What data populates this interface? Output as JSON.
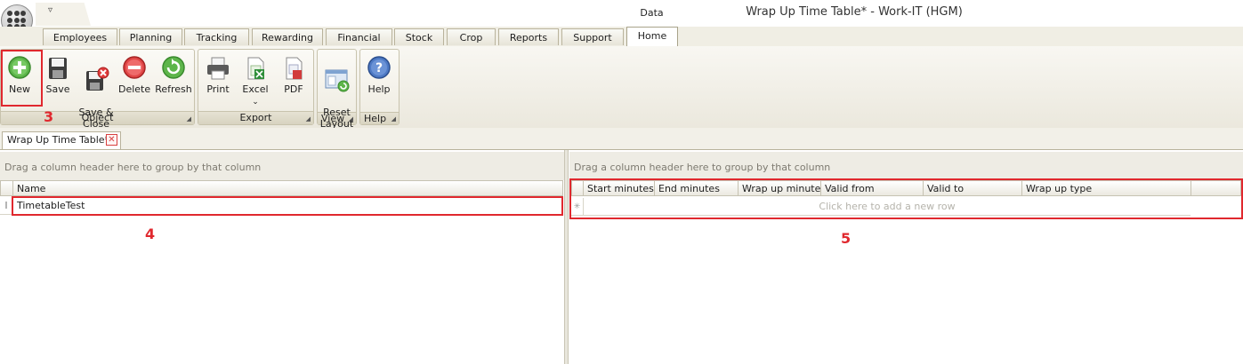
{
  "window": {
    "title": "Wrap Up Time Table* - Work-IT (HGM)",
    "context_tab": "Data"
  },
  "quick_access": {
    "arrow": "▿"
  },
  "ribbon_tabs": [
    {
      "label": "Employees"
    },
    {
      "label": "Planning"
    },
    {
      "label": "Tracking"
    },
    {
      "label": "Rewarding"
    },
    {
      "label": "Financial"
    },
    {
      "label": "Stock"
    },
    {
      "label": "Crop"
    },
    {
      "label": "Reports"
    },
    {
      "label": "Support"
    },
    {
      "label": "Home"
    }
  ],
  "active_tab": "Home",
  "ribbon": {
    "groups": {
      "object": "Object",
      "export": "Export",
      "view": "View",
      "help": "Help"
    },
    "buttons": {
      "new": "New",
      "save": "Save",
      "save_close": "Save &\nClose",
      "delete": "Delete",
      "refresh": "Refresh",
      "print": "Print",
      "excel": "Excel",
      "excel_arrow": "⌄",
      "pdf": "PDF",
      "reset_layout": "Reset\nLayout",
      "help": "Help"
    },
    "icons": {
      "new": "plus-circle-icon",
      "save": "floppy-icon",
      "save_close": "floppy-close-icon",
      "delete": "delete-circle-icon",
      "refresh": "refresh-circle-icon",
      "print": "printer-icon",
      "excel": "excel-icon",
      "pdf": "pdf-icon",
      "reset_layout": "reset-layout-icon",
      "help": "help-icon"
    }
  },
  "annotations": {
    "a3": "3",
    "a4": "4",
    "a5": "5"
  },
  "document_tab": {
    "label": "Wrap Up Time Table*",
    "close": "✕"
  },
  "left_grid": {
    "group_hint": "Drag a column header here to group by that column",
    "columns": [
      "Name"
    ],
    "rows": [
      {
        "indicator": "I",
        "name": "TimetableTest"
      }
    ]
  },
  "right_grid": {
    "group_hint": "Drag a column header here to group by that column",
    "columns": [
      "Start minutes",
      "End minutes",
      "Wrap up minutes",
      "Valid from",
      "Valid to",
      "Wrap up type"
    ],
    "new_row_indicator": "✳",
    "new_row_hint": "Click here to add a new row"
  },
  "colors": {
    "highlight": "#e0282e",
    "ribbon_bg": "#ebe8dd",
    "group_bar": "#eeece4"
  }
}
